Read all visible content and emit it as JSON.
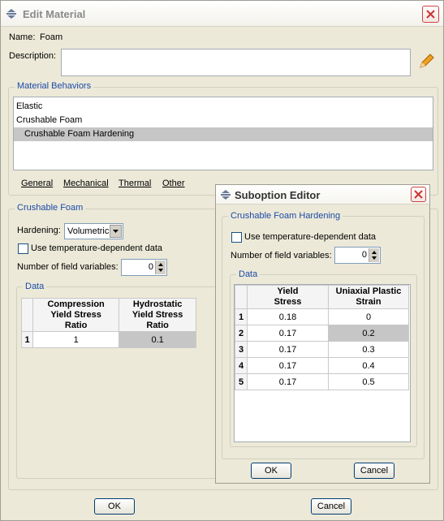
{
  "main": {
    "title": "Edit Material",
    "name_label": "Name:",
    "name_value": "Foam",
    "description_label": "Description:",
    "description_value": "",
    "behaviors_group": "Material Behaviors",
    "behaviors": [
      "Elastic",
      "Crushable Foam",
      "Crushable Foam Hardening"
    ],
    "menus": [
      "General",
      "Mechanical",
      "Thermal",
      "Other"
    ],
    "section_group": "Crushable Foam",
    "hardening_label": "Hardening:",
    "hardening_value": "Volumetric",
    "temp_dep_label": "Use temperature-dependent data",
    "field_vars_label": "Number of field variables:",
    "field_vars_value": "0",
    "data_group": "Data",
    "table": {
      "headers": [
        "Compression\nYield Stress\nRatio",
        "Hydrostatic\nYield Stress\nRatio"
      ],
      "rows": [
        {
          "n": "1",
          "cells": [
            "1",
            "0.1"
          ]
        }
      ]
    },
    "ok_label": "OK",
    "cancel_label": "Cancel"
  },
  "sub": {
    "title": "Suboption Editor",
    "section_group": "Crushable Foam Hardening",
    "temp_dep_label": "Use temperature-dependent data",
    "field_vars_label": "Number of field variables:",
    "field_vars_value": "0",
    "data_group": "Data",
    "table": {
      "headers": [
        "Yield\nStress",
        "Uniaxial Plastic\nStrain"
      ],
      "rows": [
        {
          "n": "1",
          "cells": [
            "0.18",
            "0"
          ]
        },
        {
          "n": "2",
          "cells": [
            "0.17",
            "0.2"
          ]
        },
        {
          "n": "3",
          "cells": [
            "0.17",
            "0.3"
          ]
        },
        {
          "n": "4",
          "cells": [
            "0.17",
            "0.4"
          ]
        },
        {
          "n": "5",
          "cells": [
            "0.17",
            "0.5"
          ]
        }
      ]
    },
    "ok_label": "OK",
    "cancel_label": "Cancel"
  },
  "icons": [
    "abaqus-app-icon",
    "close-icon",
    "pencil-icon",
    "spin-arrows-icon",
    "dropdown-arrow-icon"
  ],
  "colors": {
    "accent": "#1c4aa8",
    "selection": "#c6c6c6",
    "window_bg": "#ece9d8",
    "close_red": "#cc4444"
  }
}
